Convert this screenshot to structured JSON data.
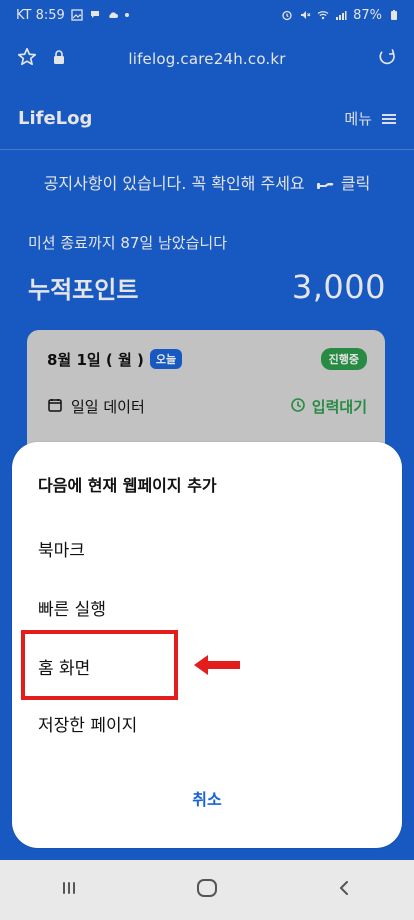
{
  "status_bar": {
    "time": "KT 8:59",
    "battery": "87%"
  },
  "browser": {
    "url": "lifelog.care24h.co.kr"
  },
  "app": {
    "logo": "LifeLog",
    "menu_label": "메뉴"
  },
  "notice": {
    "text": "공지사항이 있습니다. 꼭 확인해 주세요",
    "link": "클릭"
  },
  "mission": {
    "text": "미션 종료까지 87일 남았습니다"
  },
  "points": {
    "label": "누적포인트",
    "value": "3,000"
  },
  "card": {
    "date": "8월 1일 ( 월 )",
    "today_badge": "오늘",
    "status_badge": "진행중",
    "daily_label": "일일 데이터",
    "waiting_label": "입력대기"
  },
  "sheet": {
    "title": "다음에 현재 웹페이지 추가",
    "items": [
      "북마크",
      "빠른 실행",
      "홈 화면",
      "저장한 페이지"
    ],
    "cancel": "취소"
  },
  "colors": {
    "primary": "#1a63d7",
    "highlight": "#e31c1c",
    "success": "#2d9b4b"
  },
  "icons": {
    "star": "star-icon",
    "lock": "lock-icon",
    "refresh": "refresh-icon",
    "menu": "hamburger-icon",
    "calendar": "calendar-icon",
    "clock": "clock-icon",
    "arrow": "arrow-left-icon",
    "nav_recents": "recents-icon",
    "nav_home": "home-icon",
    "nav_back": "back-icon"
  }
}
